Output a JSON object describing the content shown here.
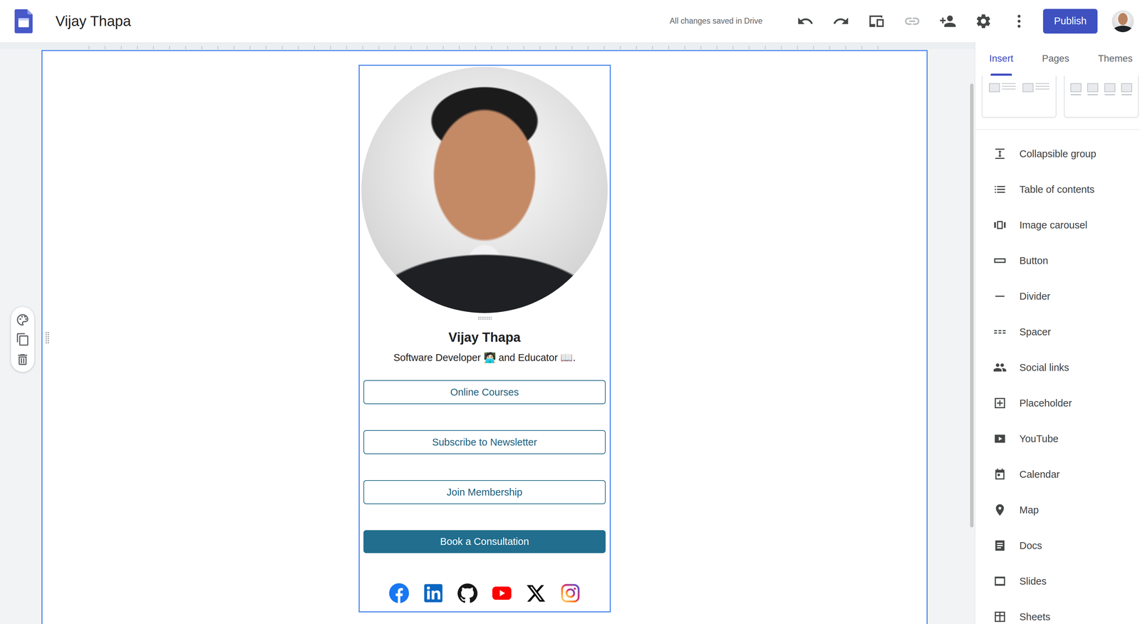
{
  "window": {
    "title": "Vijay Thapa"
  },
  "toolbar": {
    "save_status": "All changes saved in Drive",
    "publish_button": "Publish",
    "link_disabled": true
  },
  "side_panel": {
    "tabs": [
      {
        "label": "Insert",
        "selected": true
      },
      {
        "label": "Pages",
        "selected": false
      },
      {
        "label": "Themes",
        "selected": false
      }
    ],
    "insert_items": [
      {
        "label": "Collapsible group"
      },
      {
        "label": "Table of contents"
      },
      {
        "label": "Image carousel"
      },
      {
        "label": "Button"
      },
      {
        "label": "Divider"
      },
      {
        "label": "Spacer"
      },
      {
        "label": "Social links"
      },
      {
        "label": "Placeholder"
      },
      {
        "label": "YouTube"
      },
      {
        "label": "Calendar"
      },
      {
        "label": "Map"
      },
      {
        "label": "Docs"
      },
      {
        "label": "Slides"
      },
      {
        "label": "Sheets"
      }
    ]
  },
  "page": {
    "name": "Vijay Thapa",
    "bio": "Software Developer 🧑🏻‍💻 and Educator 📖.",
    "buttons": [
      {
        "label": "Online Courses",
        "kind": "outline"
      },
      {
        "label": "Subscribe to Newsletter",
        "kind": "outline"
      },
      {
        "label": "Join Membership",
        "kind": "outline"
      },
      {
        "label": "Book a Consultation",
        "kind": "filled"
      }
    ]
  }
}
